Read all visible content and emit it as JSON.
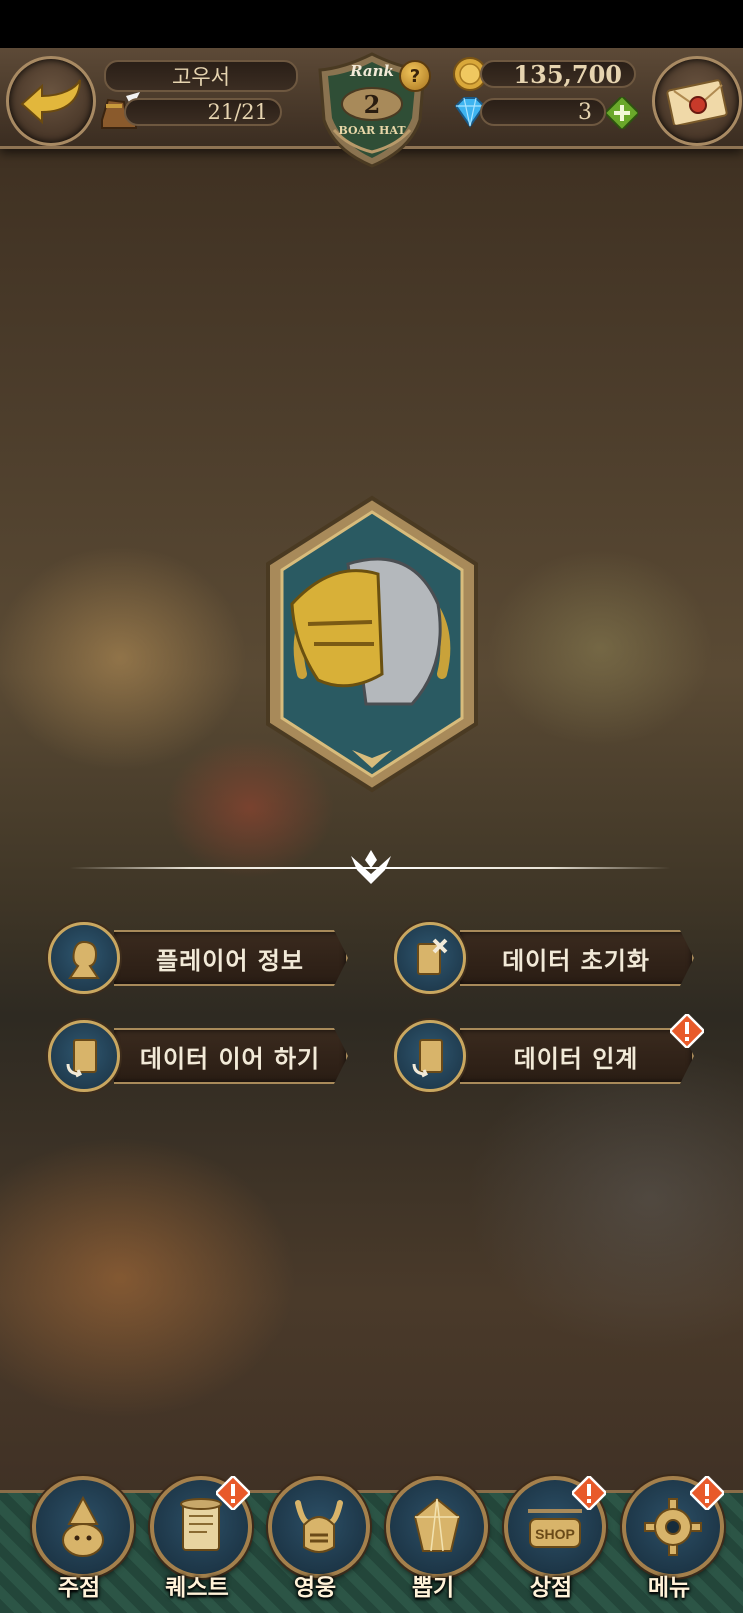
{
  "header": {
    "player_name": "고우서",
    "stamina": "21/21",
    "rank_label": "Rank",
    "rank_value": "2",
    "rank_title": "BOAR HAT",
    "rank_help": "?",
    "gold": "135,700",
    "gems": "3"
  },
  "menu": {
    "player_info": "플레이어 정보",
    "data_reset": "데이터 초기화",
    "data_continue": "데이터 이어 하기",
    "data_transfer": "데이터 인계"
  },
  "nav": [
    {
      "label": "주점",
      "icon": "tavern-icon"
    },
    {
      "label": "퀘스트",
      "icon": "quest-scroll-icon"
    },
    {
      "label": "영웅",
      "icon": "hero-helmet-icon"
    },
    {
      "label": "뽑기",
      "icon": "summon-crystal-icon"
    },
    {
      "label": "상점",
      "icon": "shop-sign-icon"
    },
    {
      "label": "메뉴",
      "icon": "gear-icon"
    }
  ],
  "colors": {
    "accent_gold": "#c9a760",
    "alert": "#e85a2a",
    "nav_green": "#2c5546"
  }
}
